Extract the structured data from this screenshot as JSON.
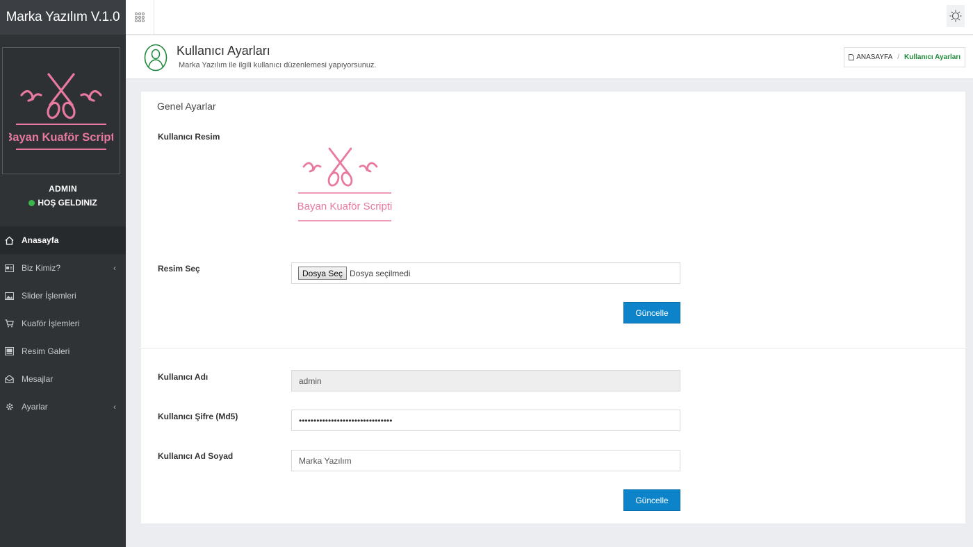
{
  "sidebar": {
    "brand": "Marka Yazılım V.1.0",
    "profile": {
      "logo_text": "Bayan Kuaför Scripti",
      "username": "ADMIN",
      "status": "HOŞ GELDINIZ"
    },
    "items": [
      {
        "label": "Anasayfa",
        "icon": "home-icon",
        "active": true
      },
      {
        "label": "Biz Kimiz?",
        "icon": "id-card-icon",
        "chevron": true
      },
      {
        "label": "Slider İşlemleri",
        "icon": "image-icon"
      },
      {
        "label": "Kuaför İşlemleri",
        "icon": "cart-icon"
      },
      {
        "label": "Resim Galeri",
        "icon": "gallery-icon"
      },
      {
        "label": "Mesajlar",
        "icon": "envelope-icon"
      },
      {
        "label": "Ayarlar",
        "icon": "gear-icon",
        "chevron": true
      }
    ]
  },
  "header": {
    "title": "Kullanıcı Ayarları",
    "subtitle": "Marka Yazılım ile ilgili kullanıcı düzenlemesi yapıyorsunuz.",
    "breadcrumb": {
      "home": "ANASAYFA",
      "separator": "/",
      "current": "Kullanıcı Ayarları"
    }
  },
  "panel": {
    "section_title": "Genel Ayarlar",
    "image_label": "Kullanıcı Resim",
    "preview_logo_text": "Bayan Kuaför Scripti",
    "file_label": "Resim Seç",
    "file_button": "Dosya Seç",
    "file_status": "Dosya seçilmedi",
    "update_button_1": "Güncelle",
    "username_label": "Kullanıcı Adı",
    "username_value": "admin",
    "password_label": "Kullanıcı Şifre (Md5)",
    "password_value": "••••••••••••••••••••••••••••••••",
    "fullname_label": "Kullanıcı Ad Soyad",
    "fullname_value": "Marka Yazılım",
    "update_button_2": "Güncelle"
  },
  "colors": {
    "sidebar_bg": "#2f3336",
    "brand_bg": "#3b3f43",
    "primary_button": "#0d84c9",
    "breadcrumb_active": "#1f8a3a",
    "status_dot": "#3bb54a",
    "logo_pink": "#e8799f"
  }
}
